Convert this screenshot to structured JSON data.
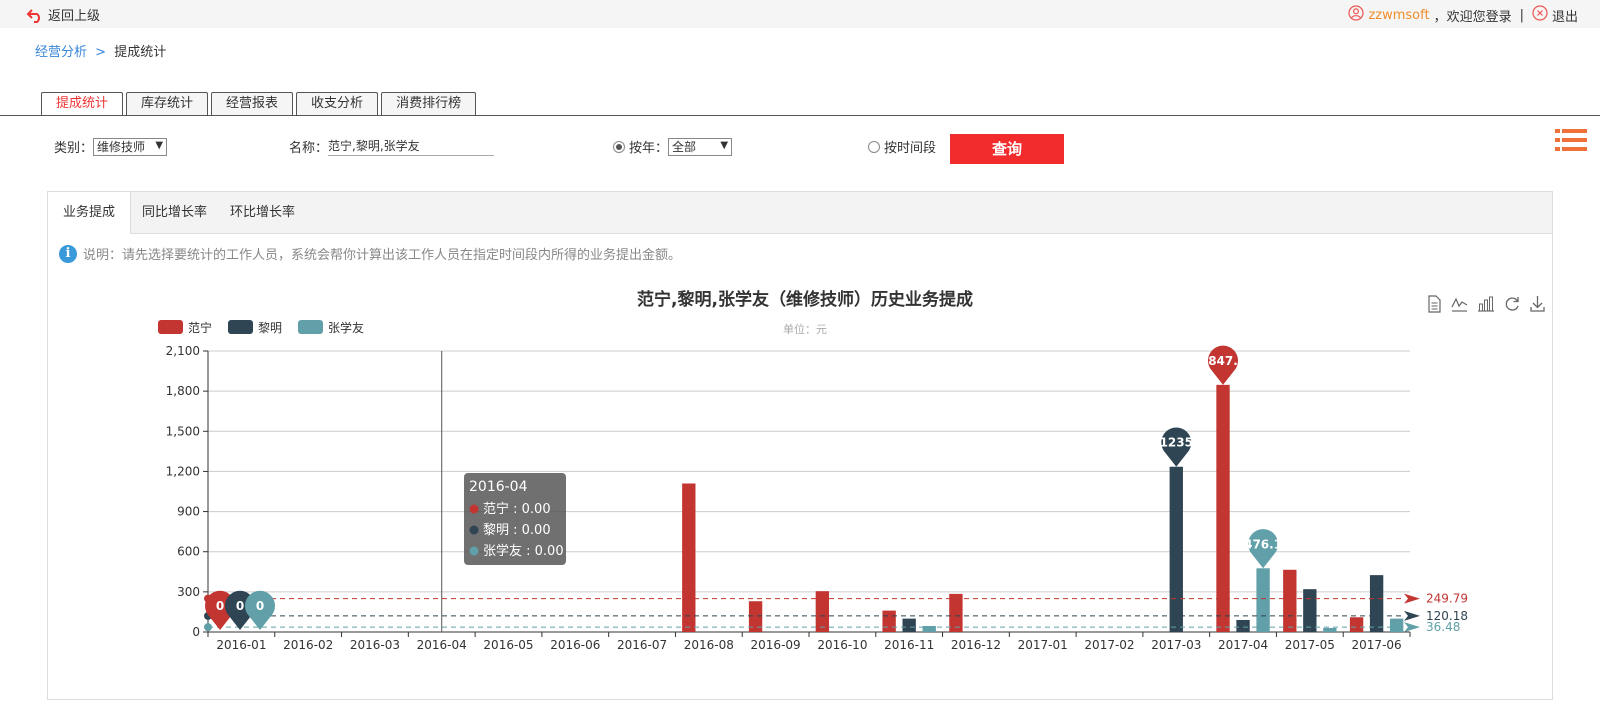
{
  "topbar": {
    "back_label": "返回上级",
    "username": "zzwmsoft",
    "welcome": "，欢迎您登录",
    "separator": "|",
    "logout": "退出"
  },
  "breadcrumb": {
    "parent": "经营分析",
    "separator": ">",
    "current": "提成统计"
  },
  "tabs": [
    {
      "label": "提成统计",
      "active": true
    },
    {
      "label": "库存统计",
      "active": false
    },
    {
      "label": "经营报表",
      "active": false
    },
    {
      "label": "收支分析",
      "active": false
    },
    {
      "label": "消费排行榜",
      "active": false
    }
  ],
  "filter": {
    "category_label": "类别：",
    "category_value": "维修技师",
    "name_label": "名称：",
    "name_value": "范宁,黎明,张学友",
    "by_year_label": "按年：",
    "year_value": "全部",
    "by_period_label": "按时间段",
    "query_button": "查询"
  },
  "subtabs": [
    "业务提成",
    "同比增长率",
    "环比增长率"
  ],
  "note": "说明：请先选择要统计的工作人员，系统会帮你计算出该工作人员在指定时间段内所得的业务提出金额。",
  "colors": {
    "fanning": "#c23531",
    "liming": "#2f4554",
    "zhangxueyou": "#61a0a8",
    "accent": "#f22c2c"
  },
  "toolbox_icons": [
    "data-view-icon",
    "line-switch-icon",
    "bar-switch-icon",
    "restore-icon",
    "save-image-icon"
  ],
  "chart_data": {
    "type": "bar",
    "title": "范宁,黎明,张学友（维修技师）历史业务提成",
    "subtitle": "单位：元",
    "legend_placement": "top-left",
    "categories": [
      "2016-01",
      "2016-02",
      "2016-03",
      "2016-04",
      "2016-05",
      "2016-06",
      "2016-07",
      "2016-08",
      "2016-09",
      "2016-10",
      "2016-11",
      "2016-12",
      "2017-01",
      "2017-02",
      "2017-03",
      "2017-04",
      "2017-05",
      "2017-06"
    ],
    "ylim": [
      0,
      2100
    ],
    "yticks": [
      "0",
      "300",
      "600",
      "900",
      "1,200",
      "1,500",
      "1,800",
      "2,100"
    ],
    "ytick_values": [
      0,
      300,
      600,
      900,
      1200,
      1500,
      1800,
      2100
    ],
    "grid": true,
    "series": [
      {
        "name": "范宁",
        "values": [
          0,
          0,
          0,
          0,
          0,
          0,
          0,
          1110,
          230,
          305,
          160,
          285,
          0,
          0,
          0,
          1847,
          465,
          110
        ],
        "max_label": "847.",
        "min_label": "0",
        "average": "249.79",
        "average_value": 249.79
      },
      {
        "name": "黎明",
        "values": [
          0,
          0,
          0,
          0,
          0,
          0,
          0,
          0,
          0,
          0,
          100,
          0,
          0,
          0,
          1235,
          90,
          320,
          425
        ],
        "max_label": "1235",
        "min_label": "0",
        "average": "120.18",
        "average_value": 120.18
      },
      {
        "name": "张学友",
        "values": [
          0,
          0,
          0,
          0,
          0,
          0,
          0,
          0,
          0,
          0,
          45,
          0,
          0,
          0,
          0,
          476.1,
          30,
          100
        ],
        "max_label": "476.1",
        "min_label": "0",
        "average": "36.48",
        "average_value": 36.48
      }
    ],
    "tooltip": {
      "category_index": 3,
      "title": "2016-04",
      "rows": [
        "范宁 : 0.00",
        "黎明 : 0.00",
        "张学友 : 0.00"
      ]
    }
  }
}
